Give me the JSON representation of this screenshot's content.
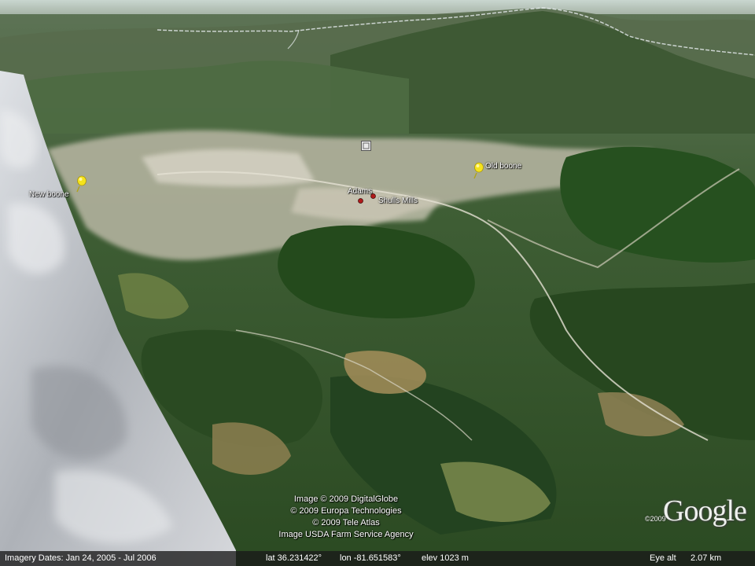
{
  "placemarks": [
    {
      "name": "New boone",
      "kind": "pushpin",
      "pin_color": "#f5e31b"
    },
    {
      "name": "Old boone",
      "kind": "pushpin",
      "pin_color": "#f5e31b"
    },
    {
      "name": "Adams",
      "kind": "dot",
      "dot_color": "#b01a1a"
    },
    {
      "name": "Shulls Mills",
      "kind": "dot",
      "dot_color": "#b01a1a"
    }
  ],
  "attribution": [
    "Image © 2009 DigitalGlobe",
    "© 2009 Europa Technologies",
    "© 2009 Tele Atlas",
    "Image USDA Farm Service Agency"
  ],
  "logo": {
    "text": "Google",
    "year": "©2009"
  },
  "status": {
    "imagery_dates": "Imagery Dates: Jan 24, 2005 - Jul 2006",
    "lat": "lat   36.231422°",
    "lon": "lon  -81.651583°",
    "elev": "elev 1023 m",
    "eye_alt_label": "Eye alt",
    "eye_alt_value": "2.07 km"
  },
  "colors": {
    "forest": "#2e4f24",
    "meadow": "#8a8a50",
    "town": "#c9c5b5",
    "cloud": "#c8cad0",
    "road": "#e8e4d8"
  },
  "icons": {
    "pin": "pushpin-icon",
    "dot": "place-dot-icon",
    "panel": "panoramio-icon"
  }
}
